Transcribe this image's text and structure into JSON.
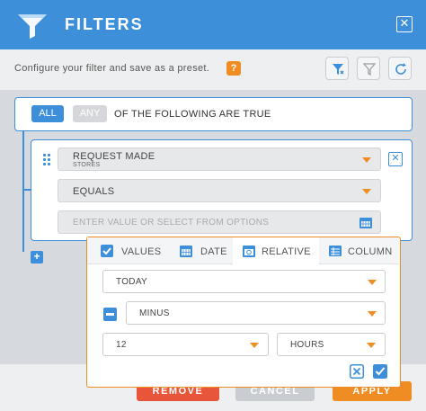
{
  "header": {
    "title": "FILTERS"
  },
  "description": "Configure your filter and save as a preset.",
  "help_label": "?",
  "rule": {
    "all_label": "ALL",
    "any_label": "ANY",
    "text": "OF THE FOLLOWING ARE TRUE"
  },
  "condition": {
    "field1": {
      "label": "REQUEST MADE",
      "sublabel": "STORES"
    },
    "field2": {
      "label": "EQUALS"
    },
    "field3": {
      "placeholder": "ENTER VALUE OR SELECT FROM OPTIONS"
    }
  },
  "add_label": "+",
  "bottom_buttons": {
    "remove": "REMOVE",
    "cancel": "CANCEL",
    "apply": "APPLY"
  },
  "popover": {
    "tabs": [
      "VALUES",
      "DATE",
      "RELATIVE",
      "COLUMN"
    ],
    "active_tab": "RELATIVE",
    "base_value": "TODAY",
    "operator": "MINUS",
    "amount": "12",
    "unit": "HOURS"
  },
  "colors": {
    "primary": "#3d8fd9",
    "accent": "#f08c24",
    "remove": "#e8553a",
    "cancel": "#c9ccd0"
  },
  "icons": {
    "header": "funnel-icon",
    "toolbar": [
      "filter-add-icon",
      "filter-clear-icon",
      "refresh-icon"
    ],
    "tabs": [
      "checkbox-icon",
      "calendar-icon",
      "calendar-relative-icon",
      "table-icon"
    ],
    "confirm": [
      "cancel-x-icon",
      "confirm-check-icon"
    ]
  }
}
